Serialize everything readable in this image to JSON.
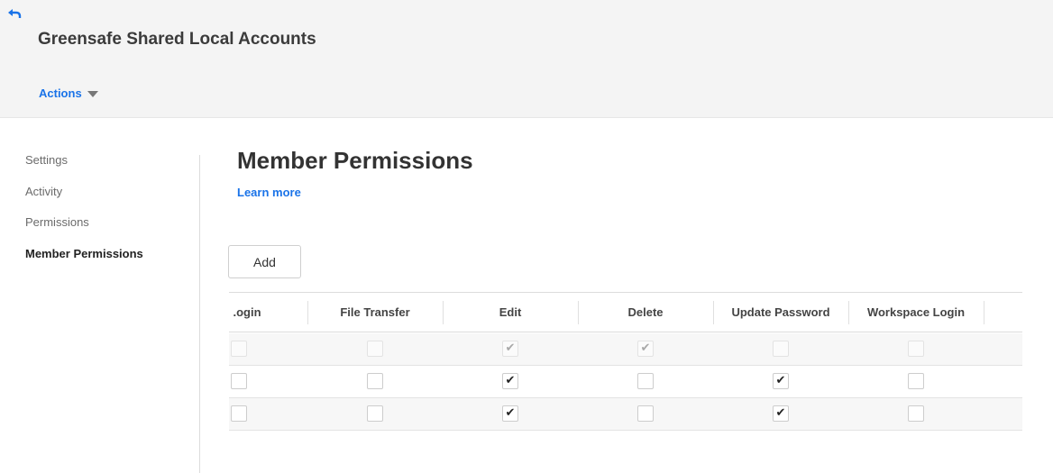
{
  "header": {
    "back_icon": "back-arrow-icon",
    "title": "Greensafe Shared Local Accounts",
    "actions_label": "Actions",
    "accent_color": "#1a73e8"
  },
  "sidebar": {
    "items": [
      {
        "label": "Settings",
        "active": false
      },
      {
        "label": "Activity",
        "active": false
      },
      {
        "label": "Permissions",
        "active": false
      },
      {
        "label": "Member Permissions",
        "active": true
      }
    ]
  },
  "main": {
    "title": "Member Permissions",
    "learn_more": "Learn more",
    "add_label": "Add"
  },
  "grid": {
    "columns": [
      ".ogin",
      "File Transfer",
      "Edit",
      "Delete",
      "Update Password",
      "Workspace Login"
    ],
    "rows": [
      {
        "disabled": true,
        "checks": [
          false,
          false,
          true,
          true,
          false,
          false
        ]
      },
      {
        "disabled": false,
        "checks": [
          false,
          false,
          true,
          false,
          true,
          false
        ]
      },
      {
        "disabled": false,
        "checks": [
          false,
          false,
          true,
          false,
          true,
          false
        ]
      }
    ]
  }
}
